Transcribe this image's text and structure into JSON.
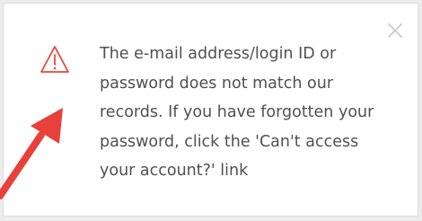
{
  "dialog": {
    "message": "The e-mail address/login ID or password does not match our records. If you have forgotten your password, click the 'Can't access your account?' link",
    "icons": {
      "status": "warning-triangle-icon",
      "close": "close-icon",
      "annotation": "red-arrow-icon"
    },
    "colors": {
      "warning": "#e8473b",
      "arrow": "#e8403a",
      "close": "#c8c8c8",
      "text": "#505050"
    }
  }
}
